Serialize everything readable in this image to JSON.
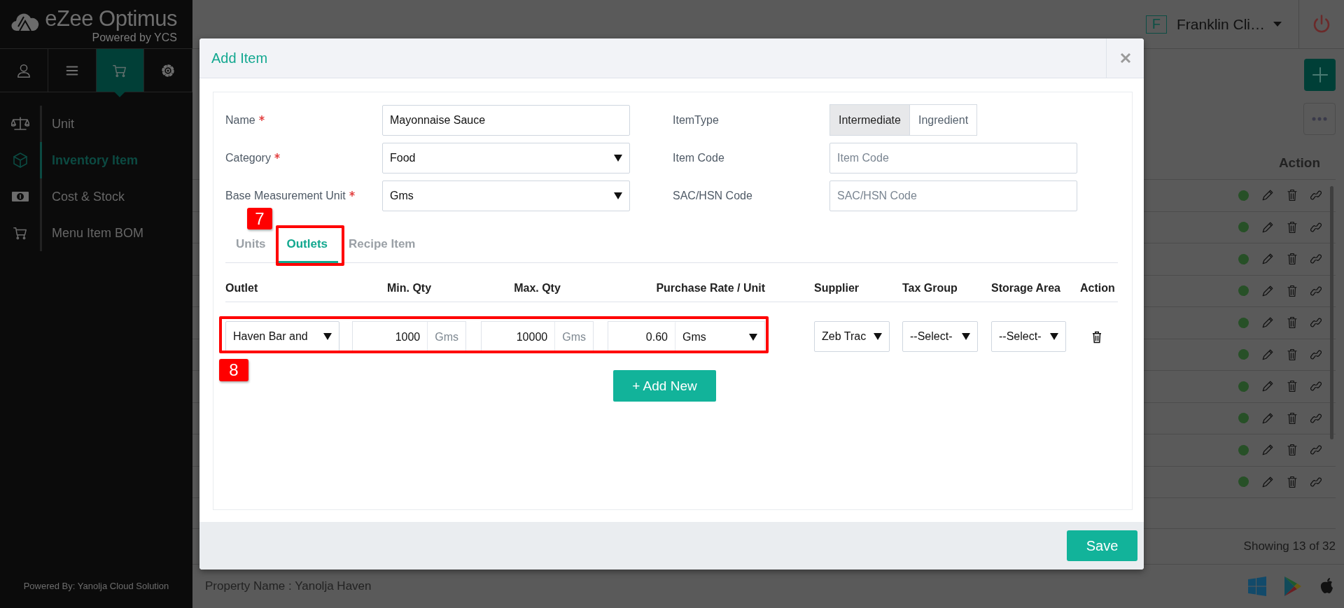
{
  "sidebar": {
    "logo_name": "eZee Optimus",
    "logo_tagline": "Powered by YCS",
    "icon_tabs": [
      {
        "kind": "user",
        "selected": false
      },
      {
        "kind": "list",
        "selected": false
      },
      {
        "kind": "cart",
        "selected": true
      },
      {
        "kind": "gear",
        "selected": false
      }
    ],
    "menu_items": [
      {
        "label": "Unit",
        "kind": "scale",
        "selected": false
      },
      {
        "label": "Inventory Item",
        "kind": "box",
        "selected": true
      },
      {
        "label": "Cost & Stock",
        "kind": "money",
        "selected": false
      },
      {
        "label": "Menu Item BOM",
        "kind": "cart",
        "selected": false
      }
    ],
    "footer": "Powered By: Yanolja Cloud Solution"
  },
  "header": {
    "user_initial": "F",
    "user_name": "Franklin Cli…"
  },
  "list": {
    "column": "Action",
    "rows": [
      {
        "active": true
      },
      {
        "active": true
      },
      {
        "active": true
      },
      {
        "active": true
      },
      {
        "active": true
      },
      {
        "active": true
      },
      {
        "active": true
      },
      {
        "active": true
      },
      {
        "active": true
      },
      {
        "active": true
      }
    ],
    "footer": "Showing 13 of 32"
  },
  "status_bar": {
    "property": "Property Name : Yanolja Haven"
  },
  "dialog": {
    "title": "Add Item",
    "fields": [
      {
        "label": "Name",
        "required": true,
        "kind": "text",
        "value": "Mayonnaise Sauce"
      },
      {
        "label": "Category",
        "required": true,
        "kind": "select",
        "value": "Food"
      },
      {
        "label": "Base Measurement Unit",
        "required": true,
        "kind": "select",
        "value": "Gms"
      }
    ],
    "item_type": {
      "label": "ItemType",
      "options": [
        {
          "label": "Intermediate",
          "selected": true
        },
        {
          "label": "Ingredient",
          "selected": false
        }
      ]
    },
    "right_fields": [
      {
        "label": "Item Code",
        "kind": "text",
        "placeholder": "Item Code"
      },
      {
        "label": "SAC/HSN Code",
        "kind": "text",
        "placeholder": "SAC/HSN Code"
      }
    ],
    "tabs": [
      {
        "label": "Units",
        "selected": false
      },
      {
        "label": "Outlets",
        "selected": true
      },
      {
        "label": "Recipe Item",
        "selected": false
      }
    ],
    "table": {
      "columns": [
        "Outlet",
        "Min. Qty",
        "Max. Qty",
        "Purchase Rate / Unit",
        "Supplier",
        "Tax Group",
        "Storage Area",
        "Action"
      ],
      "rows": [
        {
          "outlet": "Haven Bar and",
          "min_qty": "1000",
          "min_unit": "Gms",
          "max_qty": "10000",
          "max_unit": "Gms",
          "rate": "0.60",
          "rate_unit": "Gms",
          "supplier": "Zeb Trac",
          "tax_group": "--Select-",
          "storage_area": "--Select-"
        }
      ]
    },
    "add_button": "+ Add New",
    "save_button": "Save"
  },
  "annotations": [
    {
      "label": "7"
    },
    {
      "label": "8"
    }
  ]
}
